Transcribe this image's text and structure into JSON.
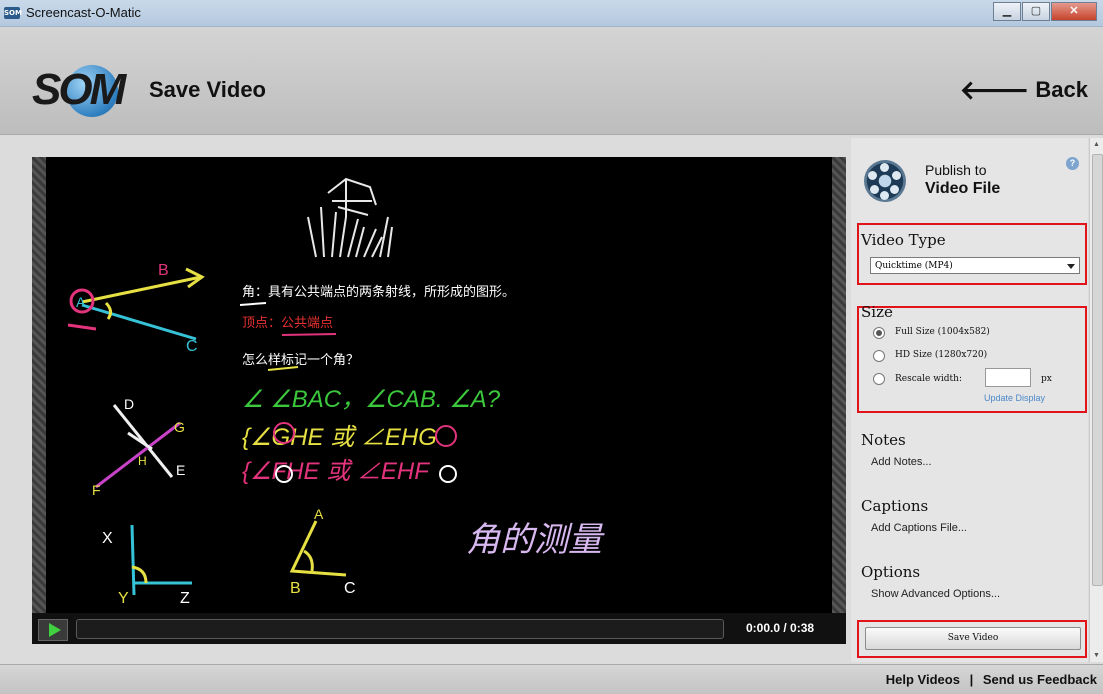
{
  "window": {
    "title": "Screencast-O-Matic",
    "icon_text": "SOM"
  },
  "header": {
    "logo_text": "SOM",
    "title": "Save Video",
    "back_label": "Back"
  },
  "player": {
    "time_display": "0:00.0 / 0:38",
    "progress": 0,
    "board_text": {
      "line1": "角：具有公共端点的两条射线，所形成的图形。",
      "line2": "顶点：公共端点",
      "line3": "怎么样标记一个角？",
      "line4": "∠  ∠BAC，∠CAB.  ∠A?",
      "line5": "{∠GHE 或 ∠EHG",
      "line6": "{∠FHE 或 ∠EHF",
      "line7": "角的测量",
      "labels": [
        "B",
        "A",
        "C",
        "D",
        "G",
        "E",
        "F",
        "H",
        "X",
        "Y",
        "Z",
        "A",
        "B",
        "C"
      ]
    }
  },
  "panel": {
    "publish_line1": "Publish to",
    "publish_line2": "Video File",
    "video_type": {
      "title": "Video Type",
      "selected": "Quicktime (MP4)"
    },
    "size": {
      "title": "Size",
      "options": [
        {
          "label": "Full Size (1004x582)",
          "selected": true
        },
        {
          "label": "HD Size (1280x720)",
          "selected": false
        },
        {
          "label": "Rescale width:",
          "selected": false
        }
      ],
      "rescale_value": "",
      "px_label": "px",
      "update_label": "Update Display"
    },
    "notes": {
      "title": "Notes",
      "link": "Add Notes..."
    },
    "captions": {
      "title": "Captions",
      "link": "Add Captions File..."
    },
    "options": {
      "title": "Options",
      "link": "Show Advanced Options..."
    },
    "save_label": "Save Video"
  },
  "footer": {
    "help_label": "Help Videos",
    "separator": "|",
    "feedback_label": "Send us Feedback"
  },
  "colors": {
    "highlight_box": "#e0141a",
    "link_blue": "#4a88c9",
    "play_green": "#3fd13f"
  }
}
